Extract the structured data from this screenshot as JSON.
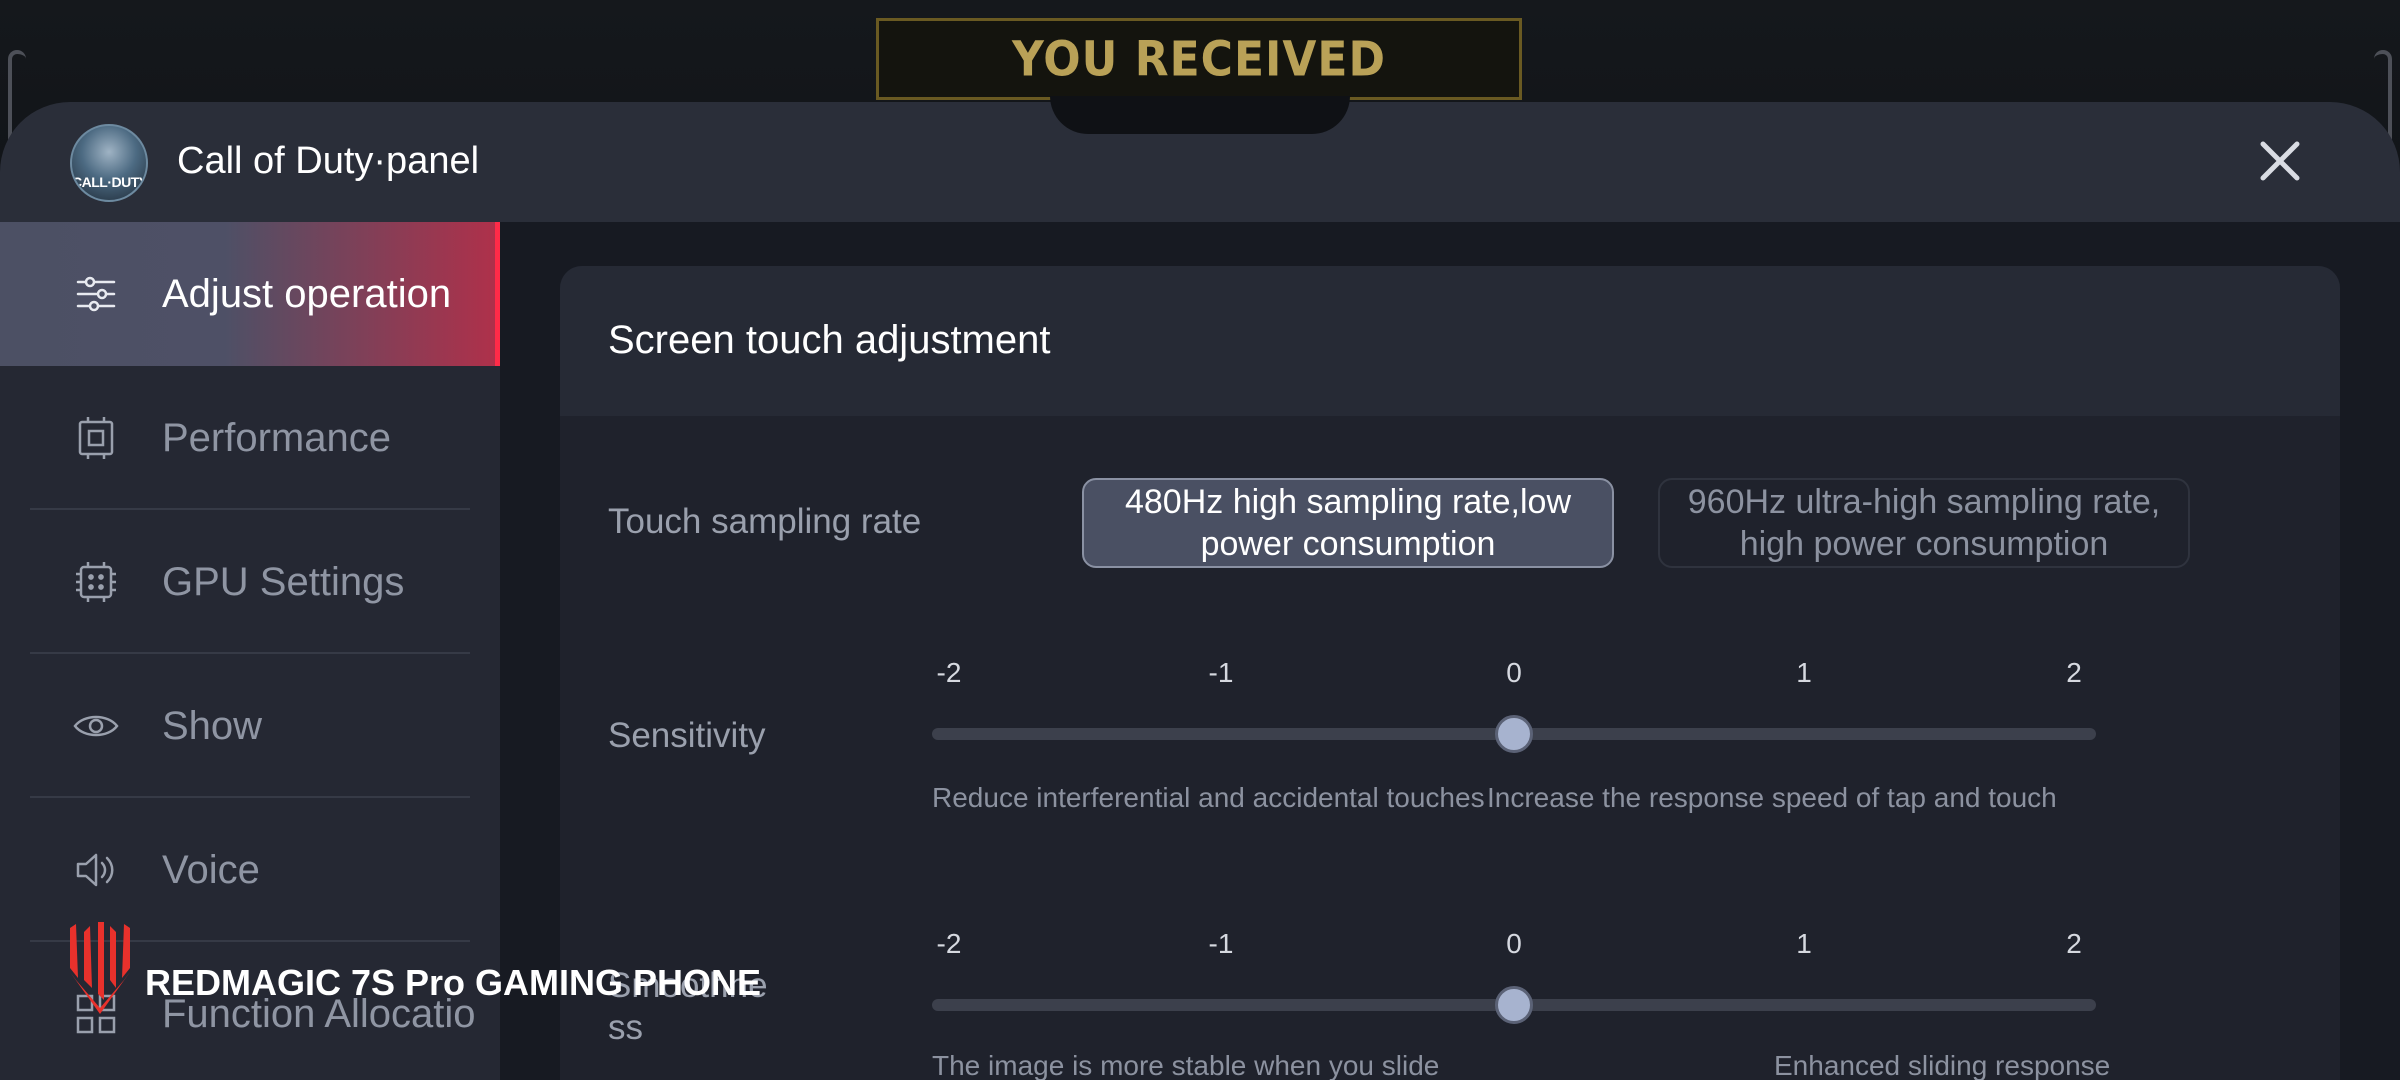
{
  "game_banner": {
    "text": "YOU RECEIVED"
  },
  "panel": {
    "game_icon_text": "CALL·DUTY",
    "title": "Call of Duty·panel"
  },
  "sidebar": {
    "items": [
      {
        "label": "Adjust operation",
        "icon": "sliders-icon",
        "active": true
      },
      {
        "label": "Performance",
        "icon": "chip-icon",
        "active": false
      },
      {
        "label": "GPU Settings",
        "icon": "gpu-chip-icon",
        "active": false
      },
      {
        "label": "Show",
        "icon": "eye-icon",
        "active": false
      },
      {
        "label": "Voice",
        "icon": "speaker-icon",
        "active": false
      },
      {
        "label": "Function Allocatio",
        "icon": "grid-icon",
        "active": false
      }
    ]
  },
  "main": {
    "section_title": "Screen touch adjustment",
    "touch_sampling": {
      "label": "Touch sampling rate",
      "options": [
        {
          "label": "480Hz high sampling rate,low power consumption",
          "selected": true
        },
        {
          "label": "960Hz ultra-high sampling rate, high power consumption",
          "selected": false
        }
      ]
    },
    "sensitivity": {
      "label": "Sensitivity",
      "ticks": [
        "-2",
        "-1",
        "0",
        "1",
        "2"
      ],
      "value": 0,
      "hint_left": "Reduce interferential and accidental touches",
      "hint_right": "Increase the response speed of tap and touch"
    },
    "smoothness": {
      "label_line1": "Smoothne",
      "label_line2": "ss",
      "ticks": [
        "-2",
        "-1",
        "0",
        "1",
        "2"
      ],
      "value": 0,
      "hint_left": "The image is more stable when you slide",
      "hint_right": "Enhanced sliding response"
    }
  },
  "watermark": {
    "text": "REDMAGIC 7S Pro GAMING PHONE"
  },
  "colors": {
    "accent": "#ff2b48",
    "panel_bg": "#2a2e39",
    "sidebar_bg": "#252833",
    "selected_option": "#4a5063",
    "slider_thumb": "#a7b3cf"
  }
}
